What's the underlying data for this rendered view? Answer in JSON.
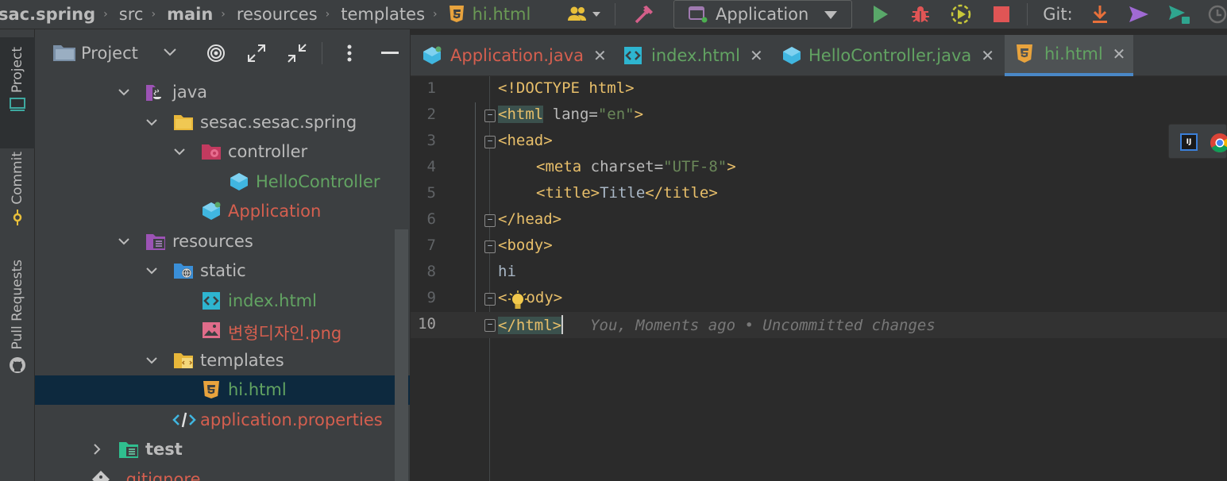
{
  "breadcrumbs": [
    {
      "label": "sac.spring",
      "bold": true
    },
    {
      "label": "src",
      "bold": false
    },
    {
      "label": "main",
      "bold": true
    },
    {
      "label": "resources",
      "bold": false
    },
    {
      "label": "templates",
      "bold": false
    },
    {
      "label": "hi.html",
      "bold": false
    }
  ],
  "toolbar": {
    "run_config": "Application",
    "git_label": "Git:"
  },
  "side_tabs": [
    "Project",
    "Commit",
    "Pull Requests"
  ],
  "project_panel": {
    "title": "Project",
    "tree": [
      {
        "label": "java",
        "color": "normal"
      },
      {
        "label": "sesac.sesac.spring",
        "color": "normal"
      },
      {
        "label": "controller",
        "color": "normal"
      },
      {
        "label": "HelloController",
        "color": "green"
      },
      {
        "label": "Application",
        "color": "red"
      },
      {
        "label": "resources",
        "color": "normal"
      },
      {
        "label": "static",
        "color": "normal"
      },
      {
        "label": "index.html",
        "color": "green"
      },
      {
        "label": "변형디자인.png",
        "color": "red"
      },
      {
        "label": "templates",
        "color": "normal"
      },
      {
        "label": "hi.html",
        "color": "green",
        "selected": true
      },
      {
        "label": "application.properties",
        "color": "red"
      },
      {
        "label": "test",
        "color": "bold"
      },
      {
        "label": ".gitignore",
        "color": "red"
      }
    ]
  },
  "editor_tabs": [
    {
      "label": "Application.java",
      "color": "#d55f4f"
    },
    {
      "label": "index.html",
      "color": "#62a362"
    },
    {
      "label": "HelloController.java",
      "color": "#62a362"
    },
    {
      "label": "hi.html",
      "color": "#62a362",
      "active": true
    }
  ],
  "editor": {
    "line_numbers": [
      "1",
      "2",
      "3",
      "4",
      "5",
      "6",
      "7",
      "8",
      "9",
      "10"
    ],
    "code": {
      "l1": "<!DOCTYPE html>",
      "l2_open": "<html",
      "l2_attr": " lang=",
      "l2_val": "\"en\"",
      "l2_close": ">",
      "l3": "<head>",
      "l4_open": "<meta",
      "l4_attr": " charset=",
      "l4_val": "\"UTF-8\"",
      "l4_close": ">",
      "l5_open": "<title>",
      "l5_text": "Title",
      "l5_close": "</title>",
      "l6": "</head>",
      "l7": "<body>",
      "l8": "hi",
      "l9_a": "<",
      "l9_b": "ody>",
      "l10": "</html>"
    },
    "blame": "You, Moments ago • Uncommitted changes"
  },
  "colors": {
    "accent_blue": "#4a88c7",
    "modified_green": "#62a362",
    "untracked_red": "#d55f4f",
    "tag_yellow": "#e8bf6a"
  }
}
